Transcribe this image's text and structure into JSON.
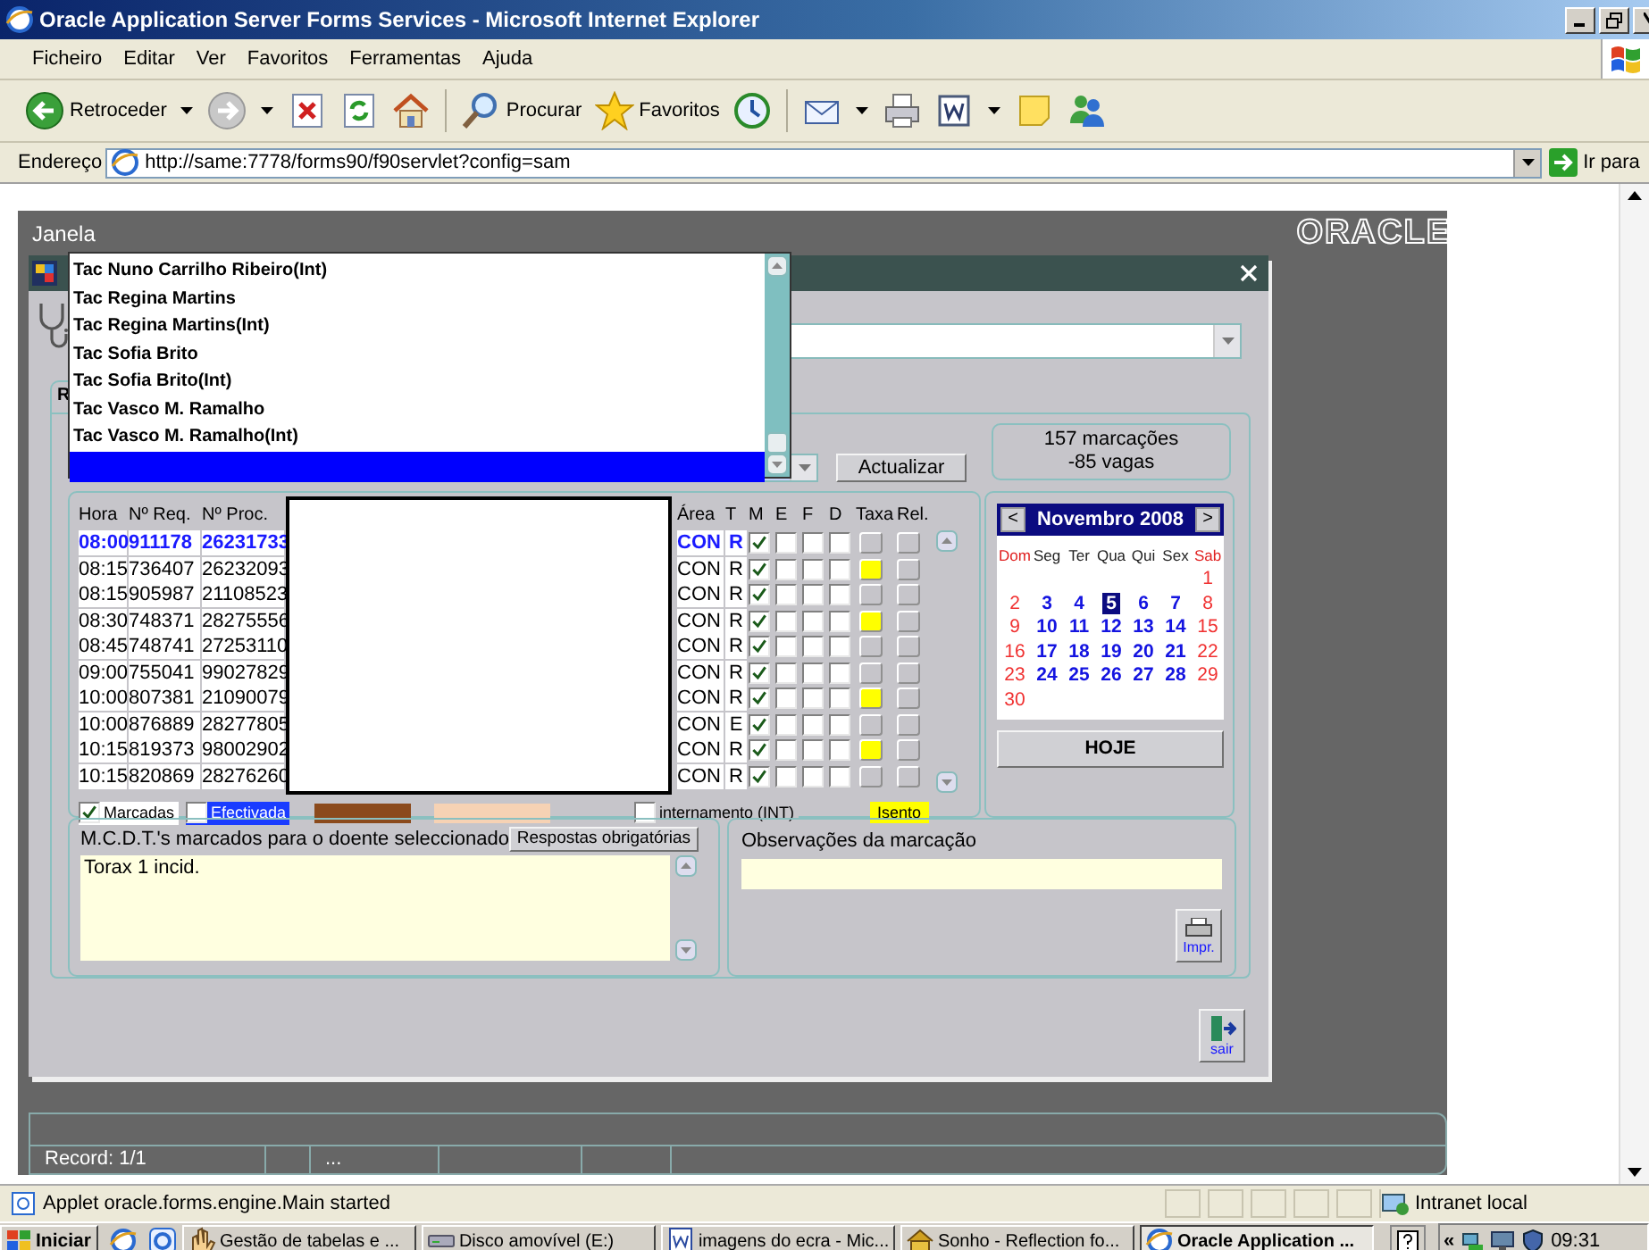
{
  "window": {
    "title": "Oracle Application Server Forms Services - Microsoft Internet Explorer"
  },
  "menu": [
    "Ficheiro",
    "Editar",
    "Ver",
    "Favoritos",
    "Ferramentas",
    "Ajuda"
  ],
  "toolbar": [
    {
      "kind": "back",
      "label": "Retroceder",
      "menu": true
    },
    {
      "kind": "forward",
      "menu": true
    },
    {
      "kind": "stop"
    },
    {
      "kind": "refresh"
    },
    {
      "kind": "home"
    },
    {
      "kind": "search",
      "label": "Procurar"
    },
    {
      "kind": "favorites",
      "label": "Favoritos"
    },
    {
      "kind": "history"
    },
    {
      "kind": "mail",
      "menu": true
    },
    {
      "kind": "print"
    },
    {
      "kind": "word",
      "menu": true
    },
    {
      "kind": "notes"
    },
    {
      "kind": "messenger"
    }
  ],
  "address": {
    "label": "Endereço",
    "url": "http://same:7778/forms90/f90servlet?config=sam",
    "go": "Ir para"
  },
  "applet": {
    "menu": "Janela",
    "logo": "ORACLE"
  },
  "form": {
    "tab": "R",
    "refresh_button": "Actualizar",
    "summary": [
      "157 marcações",
      "-85 vagas"
    ]
  },
  "lookup_list": [
    {
      "label": "Tac Nuno Carrilho Ribeiro(Int)",
      "selected": false
    },
    {
      "label": "Tac Regina Martins",
      "selected": false
    },
    {
      "label": "Tac Regina Martins(Int)",
      "selected": false
    },
    {
      "label": "Tac Sofia Brito",
      "selected": false
    },
    {
      "label": "Tac Sofia Brito(Int)",
      "selected": false
    },
    {
      "label": "Tac Vasco M. Ramalho",
      "selected": false
    },
    {
      "label": "Tac Vasco M. Ramalho(Int)",
      "selected": false
    },
    {
      "selected": true
    }
  ],
  "table": {
    "columns": [
      "Hora",
      "Nº Req.",
      "Nº Proc.",
      "Área",
      "T",
      "M",
      "E",
      "F",
      "D",
      "Taxa",
      "Rel."
    ],
    "rows": [
      {
        "selected": true,
        "hora": "08:00",
        "req": "911178",
        "proc": "26231733",
        "area": "CON",
        "t": "R",
        "m": true,
        "e": false,
        "f": false,
        "d": false,
        "isento": false
      },
      {
        "selected": false,
        "hora": "08:15",
        "req": "736407",
        "proc": "26232093",
        "area": "CON",
        "t": "R",
        "m": true,
        "e": false,
        "f": false,
        "d": false,
        "isento": true
      },
      {
        "selected": false,
        "hora": "08:15",
        "req": "905987",
        "proc": "21108523",
        "area": "CON",
        "t": "R",
        "m": true,
        "e": false,
        "f": false,
        "d": false,
        "isento": false
      },
      {
        "selected": false,
        "hora": "08:30",
        "req": "748371",
        "proc": "28275556",
        "area": "CON",
        "t": "R",
        "m": true,
        "e": false,
        "f": false,
        "d": false,
        "isento": true
      },
      {
        "selected": false,
        "hora": "08:45",
        "req": "748741",
        "proc": "27253110",
        "area": "CON",
        "t": "R",
        "m": true,
        "e": false,
        "f": false,
        "d": false,
        "isento": false
      },
      {
        "selected": false,
        "hora": "09:00",
        "req": "755041",
        "proc": "99027829",
        "area": "CON",
        "t": "R",
        "m": true,
        "e": false,
        "f": false,
        "d": false,
        "isento": false
      },
      {
        "selected": false,
        "hora": "10:00",
        "req": "807381",
        "proc": "21090079",
        "area": "CON",
        "t": "R",
        "m": true,
        "e": false,
        "f": false,
        "d": false,
        "isento": true
      },
      {
        "selected": false,
        "hora": "10:00",
        "req": "876889",
        "proc": "28277805",
        "area": "CON",
        "t": "E",
        "m": true,
        "e": false,
        "f": false,
        "d": false,
        "isento": false
      },
      {
        "selected": false,
        "hora": "10:15",
        "req": "819373",
        "proc": "98002902",
        "area": "CON",
        "t": "R",
        "m": true,
        "e": false,
        "f": false,
        "d": false,
        "isento": true
      },
      {
        "selected": false,
        "hora": "10:15",
        "req": "820869",
        "proc": "28276260",
        "area": "CON",
        "t": "R",
        "m": true,
        "e": false,
        "f": false,
        "d": false,
        "isento": false
      }
    ],
    "legend": [
      {
        "kind": "checkbox",
        "label": "Marcadas",
        "checked": true,
        "color": "#ffffff"
      },
      {
        "kind": "checkbox",
        "label": "Efectivada",
        "checked": false,
        "color": "#1a3cff"
      },
      {
        "kind": "swatch",
        "color": "#8b4a1c"
      },
      {
        "kind": "swatch",
        "color": "#f6d2b4"
      },
      {
        "kind": "checkbox",
        "label": "internamento (INT)",
        "checked": false,
        "color": "#c6c5ca"
      },
      {
        "kind": "tag",
        "label": "Isento",
        "color": "#ffff00"
      }
    ]
  },
  "calendar": {
    "month": "Novembro 2008",
    "prev": "<",
    "next": ">",
    "weekdays": [
      {
        "label": "Dom",
        "weekend": true
      },
      {
        "label": "Seg",
        "weekend": false
      },
      {
        "label": "Ter",
        "weekend": false
      },
      {
        "label": "Qua",
        "weekend": false
      },
      {
        "label": "Qui",
        "weekend": false
      },
      {
        "label": "Sex",
        "weekend": false
      },
      {
        "label": "Sab",
        "weekend": true
      }
    ],
    "weeks": [
      {
        "days": [
          {
            "day": "1",
            "selected": false
          }
        ]
      },
      {
        "days": [
          {
            "day": "2",
            "selected": false
          },
          {
            "day": "3",
            "selected": false
          },
          {
            "day": "4",
            "selected": false
          },
          {
            "day": "5",
            "selected": true
          },
          {
            "day": "6",
            "selected": false
          },
          {
            "day": "7",
            "selected": false
          },
          {
            "day": "8",
            "selected": false
          }
        ]
      },
      {
        "days": [
          {
            "day": "9",
            "selected": false
          },
          {
            "day": "10",
            "selected": false
          },
          {
            "day": "11",
            "selected": false
          },
          {
            "day": "12",
            "selected": false
          },
          {
            "day": "13",
            "selected": false
          },
          {
            "day": "14",
            "selected": false
          },
          {
            "day": "15",
            "selected": false
          }
        ]
      },
      {
        "days": [
          {
            "day": "16",
            "selected": false
          },
          {
            "day": "17",
            "selected": false
          },
          {
            "day": "18",
            "selected": false
          },
          {
            "day": "19",
            "selected": false
          },
          {
            "day": "20",
            "selected": false
          },
          {
            "day": "21",
            "selected": false
          },
          {
            "day": "22",
            "selected": false
          }
        ]
      },
      {
        "days": [
          {
            "day": "23",
            "selected": false
          },
          {
            "day": "24",
            "selected": false
          },
          {
            "day": "25",
            "selected": false
          },
          {
            "day": "26",
            "selected": false
          },
          {
            "day": "27",
            "selected": false
          },
          {
            "day": "28",
            "selected": false
          },
          {
            "day": "29",
            "selected": false
          }
        ]
      },
      {
        "days": [
          {
            "day": "30",
            "selected": false
          }
        ]
      }
    ],
    "today_button": "HOJE"
  },
  "mcdt": {
    "label": "M.C.D.T.'s marcados para o doente seleccionado",
    "button": "Respostas obrigatórias",
    "text": "Torax 1 incid."
  },
  "observations": {
    "label": "Observações da marcação",
    "print_button": "Impr."
  },
  "exit_button": "sair",
  "record_bar": {
    "record": "Record: 1/1",
    "field_3": "..."
  },
  "status_bar": {
    "text": "Applet oracle.forms.engine.Main started",
    "zone": "Intranet local"
  },
  "taskbar": {
    "start": "Iniciar",
    "tasks": [
      {
        "kind": "tools",
        "label": "Gestão de tabelas e ...",
        "selected": false
      },
      {
        "kind": "drive",
        "label": "Disco amovível (E:)",
        "selected": false
      },
      {
        "kind": "word",
        "label": "imagens do ecra - Mic...",
        "selected": false
      },
      {
        "kind": "house",
        "label": "Sonho - Reflection fo...",
        "selected": false
      },
      {
        "kind": "ie",
        "label": "Oracle Application ...",
        "selected": true
      }
    ],
    "tray": "«",
    "clock": "09:31"
  }
}
